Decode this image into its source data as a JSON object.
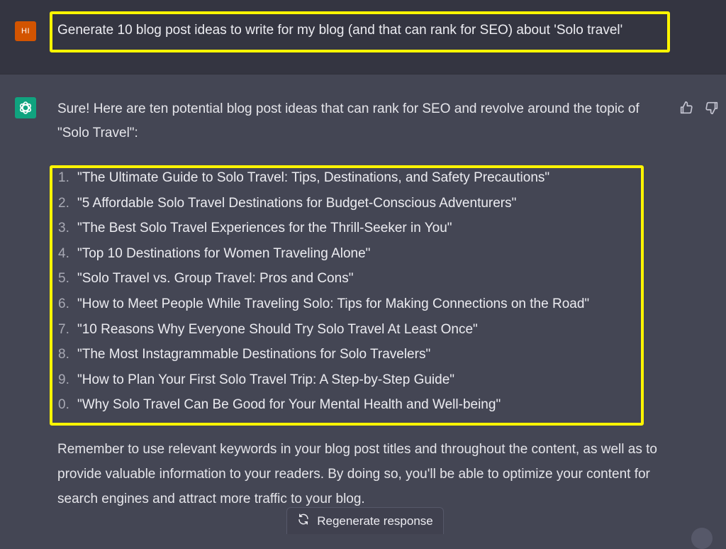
{
  "user": {
    "avatar_initials": "HI",
    "message": "Generate 10 blog post ideas to write for my blog (and that can rank for SEO) about 'Solo travel'"
  },
  "assistant": {
    "avatar_icon": "openai-logo-icon",
    "intro": "Sure! Here are ten potential blog post ideas that can rank for SEO and revolve around the topic of \"Solo Travel\":",
    "ideas": [
      {
        "num": "1.",
        "text": "\"The Ultimate Guide to Solo Travel: Tips, Destinations, and Safety Precautions\""
      },
      {
        "num": "2.",
        "text": "\"5 Affordable Solo Travel Destinations for Budget-Conscious Adventurers\""
      },
      {
        "num": "3.",
        "text": "\"The Best Solo Travel Experiences for the Thrill-Seeker in You\""
      },
      {
        "num": "4.",
        "text": "\"Top 10 Destinations for Women Traveling Alone\""
      },
      {
        "num": "5.",
        "text": "\"Solo Travel vs. Group Travel: Pros and Cons\""
      },
      {
        "num": "6.",
        "text": "\"How to Meet People While Traveling Solo: Tips for Making Connections on the Road\""
      },
      {
        "num": "7.",
        "text": "\"10 Reasons Why Everyone Should Try Solo Travel At Least Once\""
      },
      {
        "num": "8.",
        "text": "\"The Most Instagrammable Destinations for Solo Travelers\""
      },
      {
        "num": "9.",
        "text": "\"How to Plan Your First Solo Travel Trip: A Step-by-Step Guide\""
      },
      {
        "num": "0.",
        "text": "\"Why Solo Travel Can Be Good for Your Mental Health and Well-being\""
      }
    ],
    "outro": "Remember to use relevant keywords in your blog post titles and throughout the content, as well as to provide valuable information to your readers. By doing so, you'll be able to optimize your content for search engines and attract more traffic to your blog.",
    "feedback": {
      "up_icon": "thumbs-up-icon",
      "down_icon": "thumbs-down-icon"
    }
  },
  "footer": {
    "regenerate_label": "Regenerate response",
    "regenerate_icon": "refresh-icon"
  },
  "colors": {
    "page_bg": "#444654",
    "user_row_bg": "#343541",
    "highlight": "#fff500",
    "user_avatar": "#d35400",
    "bot_avatar": "#10a37f"
  }
}
